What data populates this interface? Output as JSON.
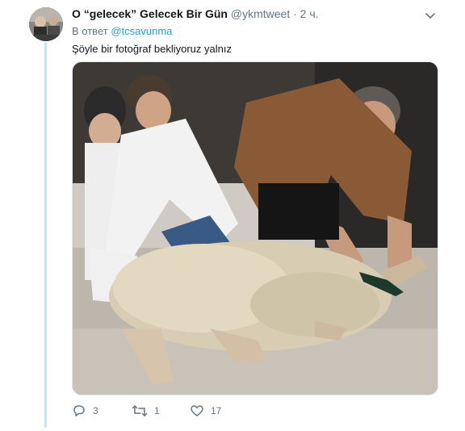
{
  "tweet": {
    "display_name": "O “gelecek” Gelecek Bir Gün",
    "handle": "@ykmtweet",
    "separator": "·",
    "time": "2 ч.",
    "reply_prefix": "В ответ",
    "reply_handle": "@tcsavunma",
    "text": "Şöyle bir fotoğraf bekliyoruz yalnız",
    "media_alt": "photo"
  },
  "actions": {
    "reply_icon": "reply-icon",
    "reply_count": "3",
    "retweet_icon": "retweet-icon",
    "retweet_count": "1",
    "like_icon": "heart-icon",
    "like_count": "17"
  },
  "colors": {
    "accent": "#1da1f2",
    "muted": "#657786",
    "thread_line": "#c3e5fb"
  }
}
